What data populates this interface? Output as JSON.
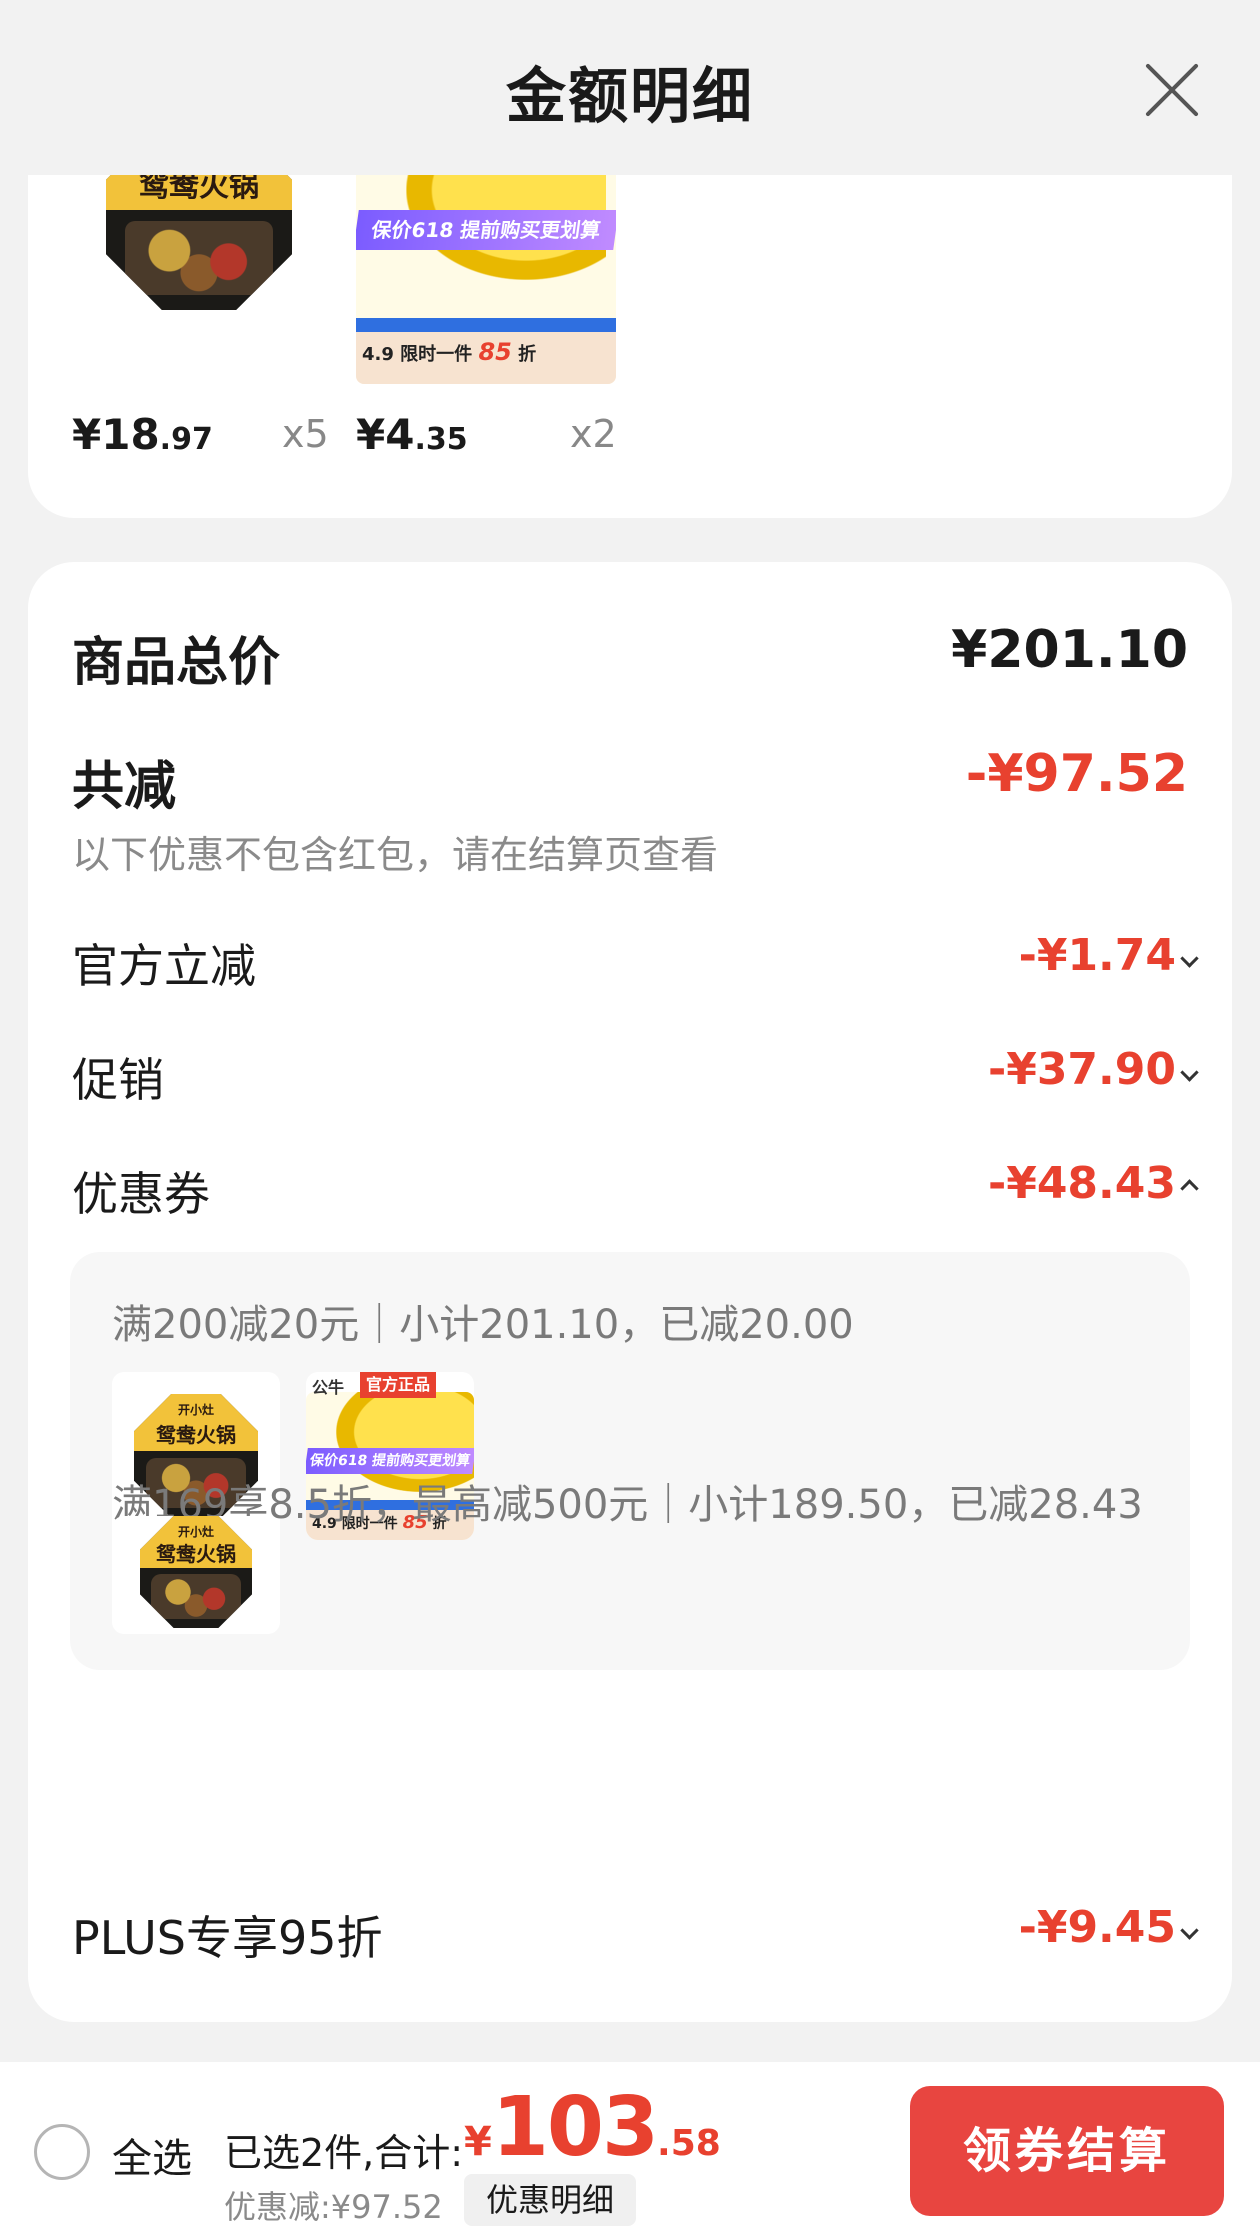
{
  "header": {
    "title": "金额明细",
    "close_icon": "close-icon"
  },
  "top_items": [
    {
      "name": "鸳鸯火锅",
      "brand": "开小灶",
      "price_int": "¥18",
      "price_dec": ".97",
      "qty": "x5"
    },
    {
      "name": "保价618 提前购买更划算",
      "price_int": "¥4",
      "price_dec": ".35",
      "qty": "x2",
      "promo_price": "4.9",
      "promo_text": "限时一件",
      "promo_discount": "85",
      "promo_unit": "折"
    }
  ],
  "summary": {
    "goods_total_label": "商品总价",
    "goods_total_value": "¥201.10",
    "total_discount_label": "共减",
    "total_discount_value": "-¥97.52",
    "note": "以下优惠不包含红包，请在结算页查看",
    "rows": [
      {
        "label": "官方立减",
        "value": "-¥1.74",
        "expanded": false
      },
      {
        "label": "促销",
        "value": "-¥37.90",
        "expanded": false
      },
      {
        "label": "优惠券",
        "value": "-¥48.43",
        "expanded": true
      }
    ],
    "plus_row": {
      "label": "PLUS专享95折",
      "value": "-¥9.45",
      "expanded": false
    }
  },
  "coupons": [
    {
      "desc": "满200减20元｜小计201.10，已减20.00"
    },
    {
      "desc": "满169享8.5折，最高减500元｜小计189.50，已减28.43"
    }
  ],
  "coupon_thumb": {
    "official_tag": "官方正品",
    "brand_tag": "公牛"
  },
  "bottom_bar": {
    "select_all": "全选",
    "selected_text": "已选2件,合计:",
    "currency": "¥",
    "total_int": "103",
    "total_dec": ".58",
    "saved_text": "优惠减:¥97.52",
    "detail_chip": "优惠明细",
    "checkout": "领券结算"
  },
  "colors": {
    "accent_red": "#e8412f",
    "checkout_bg": "#e84540"
  }
}
